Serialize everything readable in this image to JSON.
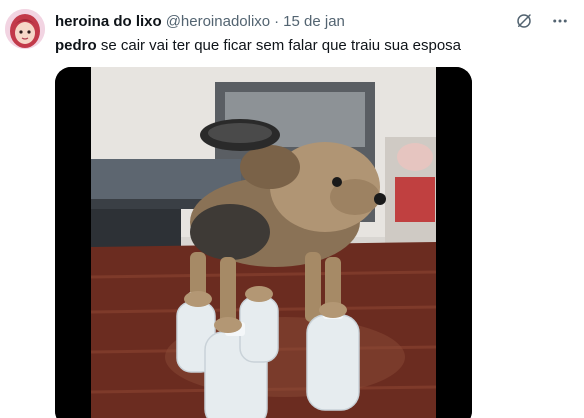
{
  "author": {
    "display_name": "heroina do lixo",
    "handle": "@heroinadolixo",
    "separator": "·",
    "timestamp": "15 de jan"
  },
  "tweet": {
    "bold_word": "pedro",
    "text_rest": " se cair vai ter que ficar sem falar que traiu sua esposa"
  },
  "icons": {
    "grok": "grok-icon",
    "more": "more-options-icon"
  },
  "media": {
    "type": "video",
    "description_icon": "video-thumbnail"
  },
  "colors": {
    "secondary_text": "#536471",
    "primary_text": "#0f1419"
  }
}
